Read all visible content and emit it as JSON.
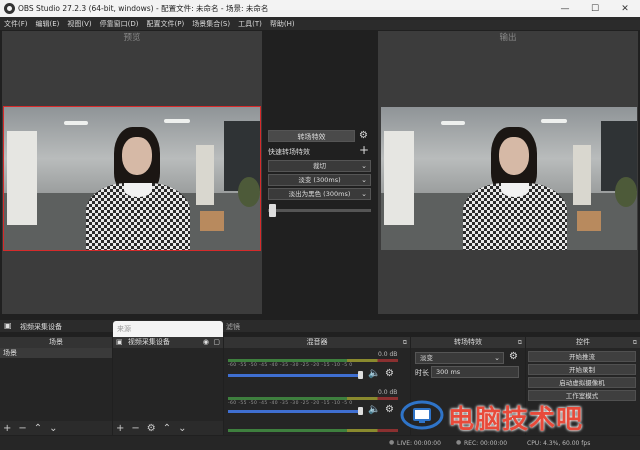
{
  "window": {
    "title": "OBS Studio 27.2.3 (64-bit, windows) - 配置文件: 未命名 - 场景: 未命名",
    "minimize": "—",
    "maximize": "☐",
    "close": "✕"
  },
  "menu": [
    "文件(F)",
    "编辑(E)",
    "视图(V)",
    "停靠窗口(D)",
    "配置文件(P)",
    "场景集合(S)",
    "工具(T)",
    "帮助(H)"
  ],
  "preview": {
    "label": "预览"
  },
  "program": {
    "label": "输出"
  },
  "transitions": {
    "button": "转场特效",
    "quick_label": "快速转场特效",
    "items": [
      "裁切",
      "淡变 (300ms)",
      "淡出为黑色 (300ms)"
    ]
  },
  "source_bar": {
    "label": "视频采集设备",
    "tab_right": "滤镜"
  },
  "scenes_dock": {
    "title": "场景",
    "items": [
      "场景"
    ]
  },
  "sources_dock": {
    "title": "来源",
    "items": [
      "视频采集设备"
    ]
  },
  "mixer_dock": {
    "title": "混音器",
    "tracks": [
      {
        "db": "0.0 dB",
        "ticks": "-60 -55 -50 -45 -40 -35 -30 -25 -20 -15 -10 -5 0"
      },
      {
        "db": "0.0 dB",
        "ticks": "-60 -55 -50 -45 -40 -35 -30 -25 -20 -15 -10 -5 0"
      }
    ]
  },
  "transition_dock": {
    "title": "转场特效",
    "selected": "淡变",
    "duration_label": "时长",
    "duration_value": "300 ms"
  },
  "controls_dock": {
    "title": "控件",
    "buttons": [
      "开始推流",
      "开始录制",
      "启动虚拟摄像机",
      "工作室模式"
    ]
  },
  "status": {
    "live": "LIVE: 00:00:00",
    "rec": "REC: 00:00:00",
    "cpu": "CPU: 4.3%, 60.00 fps"
  },
  "watermark": {
    "text": "电脑技术吧"
  },
  "colors": {
    "accent": "#3f6fd1",
    "selection_border": "#d62b2b",
    "watermark": "#e84a3a"
  }
}
